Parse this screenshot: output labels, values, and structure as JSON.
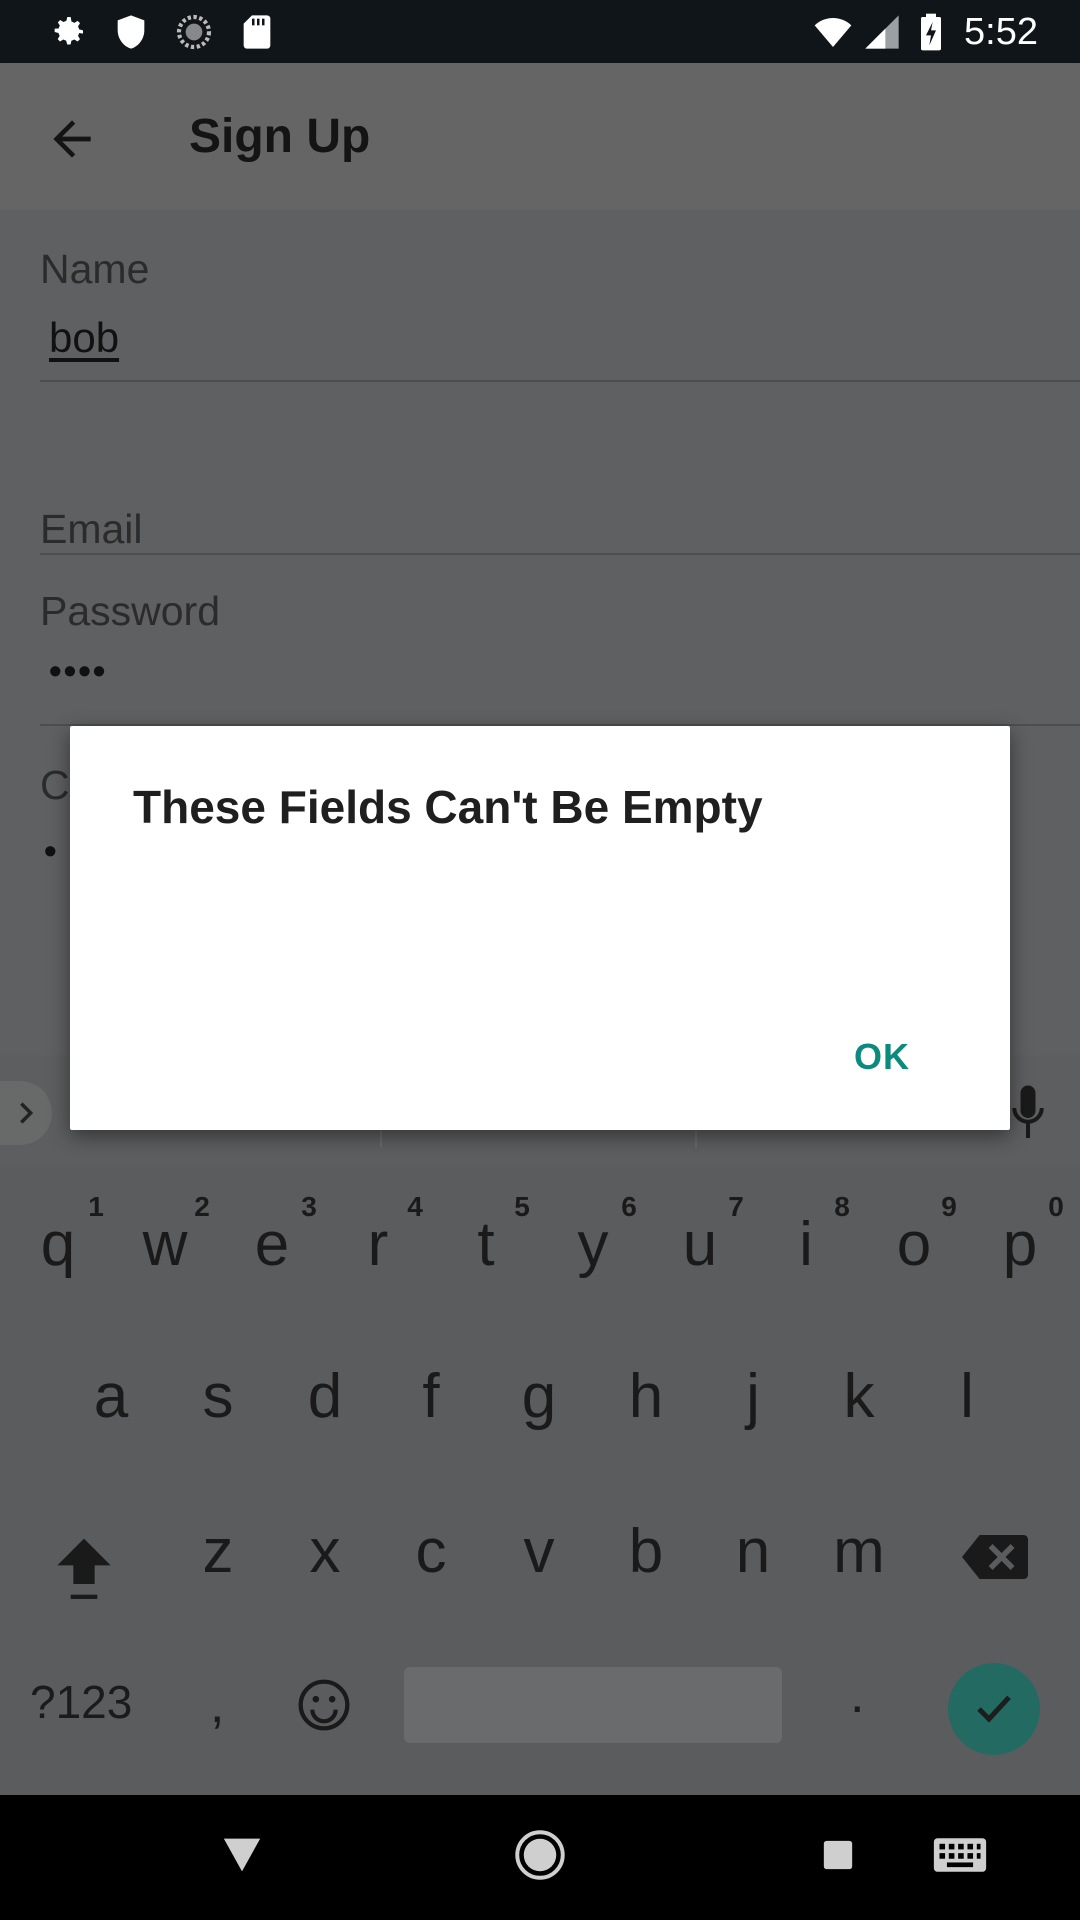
{
  "status_bar": {
    "time": "5:52",
    "left_icons": [
      "gear-icon",
      "shield-icon",
      "sync-icon",
      "sd-card-icon"
    ],
    "right_icons": [
      "wifi-icon",
      "signal-icon",
      "battery-charging-icon"
    ]
  },
  "app_bar": {
    "title": "Sign Up",
    "back_icon": "arrow-back-icon"
  },
  "form": {
    "name": {
      "label": "Name",
      "value": "bob"
    },
    "email": {
      "label": "Email",
      "value": ""
    },
    "password": {
      "label": "Password",
      "value": "••••"
    },
    "confirm_partial": {
      "label_visible": "C",
      "value_visible": "•"
    }
  },
  "dialog": {
    "title": "These Fields Can't Be Empty",
    "ok_label": "OK"
  },
  "keyboard": {
    "row1": [
      "q",
      "w",
      "e",
      "r",
      "t",
      "y",
      "u",
      "i",
      "o",
      "p"
    ],
    "row1_hints": [
      "1",
      "2",
      "3",
      "4",
      "5",
      "6",
      "7",
      "8",
      "9",
      "0"
    ],
    "row2": [
      "a",
      "s",
      "d",
      "f",
      "g",
      "h",
      "j",
      "k",
      "l"
    ],
    "row3": [
      "z",
      "x",
      "c",
      "v",
      "b",
      "n",
      "m"
    ],
    "symbols_label": "?123",
    "comma": ",",
    "period": ".",
    "accent_color": "#236b62"
  },
  "nav_bar": {
    "icons": [
      "back-triangle-icon",
      "home-circle-icon",
      "recents-square-icon",
      "keyboard-icon"
    ]
  }
}
